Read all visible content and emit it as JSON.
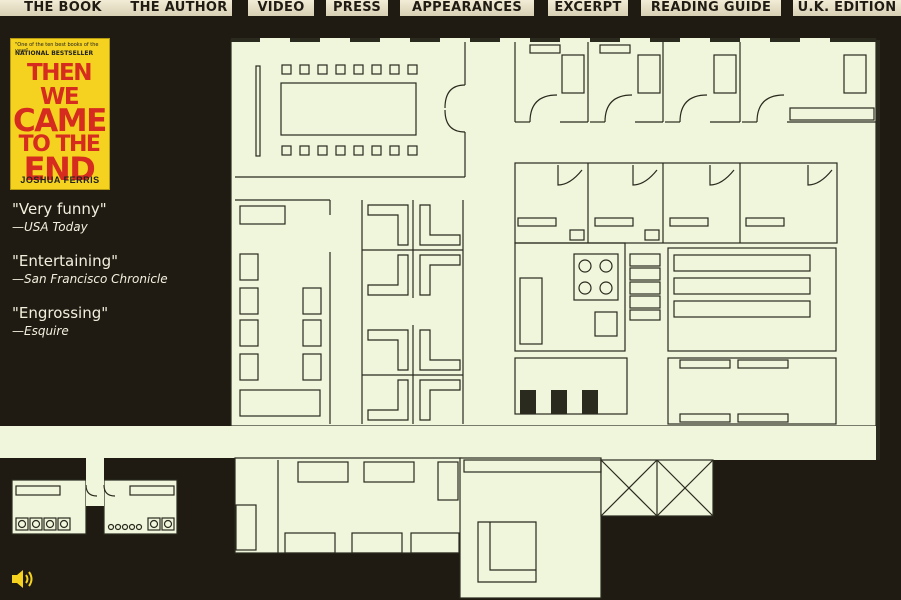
{
  "nav": {
    "items": [
      {
        "id": "the-book",
        "label": "THE BOOK"
      },
      {
        "id": "the-author",
        "label": "THE AUTHOR"
      },
      {
        "id": "video",
        "label": "VIDEO"
      },
      {
        "id": "press",
        "label": "PRESS"
      },
      {
        "id": "appearances",
        "label": "APPEARANCES"
      },
      {
        "id": "excerpt",
        "label": "EXCERPT"
      },
      {
        "id": "reading-guide",
        "label": "READING GUIDE"
      },
      {
        "id": "uk-edition",
        "label": "U.K. EDITION"
      }
    ]
  },
  "cover": {
    "blurb": "\"One of the ten best books of the year\"",
    "badge": "NATIONAL BESTSELLER",
    "title_lines": [
      "THEN WE",
      "CAME",
      "TO THE",
      "END"
    ],
    "author": "JOSHUA FERRIS"
  },
  "quotes": [
    {
      "text": "\"Very funny\"",
      "source": "—USA Today"
    },
    {
      "text": "\"Entertaining\"",
      "source": "—San Francisco Chronicle"
    },
    {
      "text": "\"Engrossing\"",
      "source": "—Esquire"
    }
  ],
  "colors": {
    "background": "#1f1b12",
    "floor": "#f0f6dc",
    "line": "#2a2a1e",
    "cover": "#f4d21f",
    "cover_title": "#d62b1f"
  },
  "icons": {
    "sound": "speaker-icon"
  }
}
